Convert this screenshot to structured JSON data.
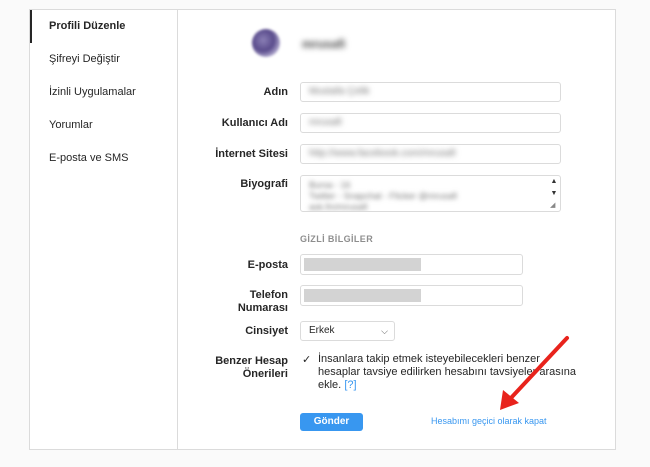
{
  "sidebar": {
    "items": [
      {
        "label": "Profili Düzenle",
        "active": true
      },
      {
        "label": "Şifreyi Değiştir",
        "active": false
      },
      {
        "label": "İzinli Uygulamalar",
        "active": false
      },
      {
        "label": "Yorumlar",
        "active": false
      },
      {
        "label": "E-posta ve SMS",
        "active": false
      }
    ]
  },
  "profile": {
    "username_display": "mrusafi"
  },
  "form": {
    "name": {
      "label": "Adın",
      "value": "Mustafa Çelik"
    },
    "username": {
      "label": "Kullanıcı Adı",
      "value": "mrusafi"
    },
    "website": {
      "label": "İnternet Sitesi",
      "value": "http://www.facebook.com/mrusafi"
    },
    "bio": {
      "label": "Biyografi",
      "lines": [
        "Bursa - 16",
        "Twitter - Snapchat - Flicker @mrusafi",
        "ask.fm/mrusafi"
      ]
    },
    "private_section_title": "GİZLİ BİLGİLER",
    "email": {
      "label": "E-posta"
    },
    "phone": {
      "label_line1": "Telefon",
      "label_line2": "Numarası"
    },
    "gender": {
      "label": "Cinsiyet",
      "value": "Erkek"
    },
    "similar": {
      "label_line1": "Benzer Hesap",
      "label_line2": "Önerileri",
      "checkmark": "✓",
      "text_line1": "İnsanlara takip etmek isteyebilecekleri benzer",
      "text_line2": "hesaplar tavsiye edilirken hesabını tavsiyeler arasına",
      "text_line3": "ekle.",
      "help": "[?]",
      "checked": true
    },
    "submit_label": "Gönder",
    "disable_link": "Hesabımı geçici olarak kapat"
  },
  "colors": {
    "accent": "#3897f0",
    "annotation_arrow": "#e8231c"
  },
  "icons": {
    "select_chevron": "chevron-down-icon",
    "scroll_up": "triangle-up-icon",
    "scroll_down": "triangle-down-icon",
    "resize": "resize-grip-icon"
  }
}
